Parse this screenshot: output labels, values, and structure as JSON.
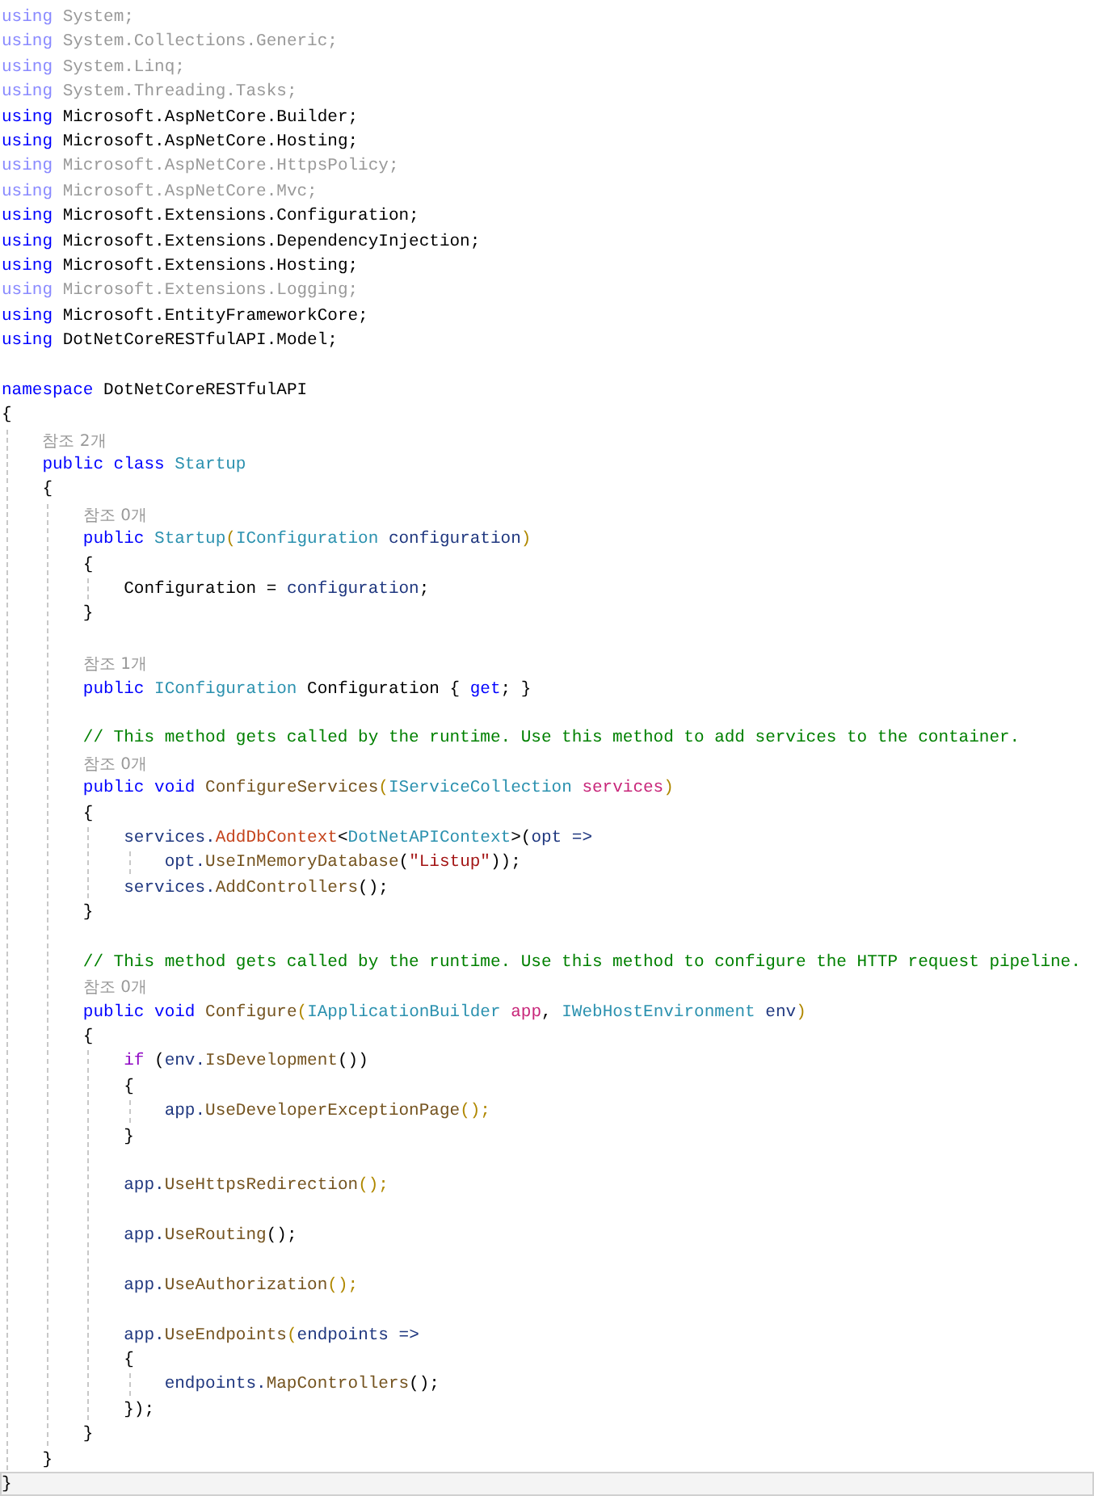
{
  "lines": [
    {
      "kind": "code",
      "current": false,
      "tokens": [
        {
          "text": "using",
          "kind": "kwf"
        },
        {
          "text": " System;",
          "kind": "fade"
        }
      ]
    },
    {
      "kind": "code",
      "current": false,
      "tokens": [
        {
          "text": "using",
          "kind": "kwf"
        },
        {
          "text": " System.Collections.Generic;",
          "kind": "fade"
        }
      ]
    },
    {
      "kind": "code",
      "current": false,
      "tokens": [
        {
          "text": "using",
          "kind": "kwf"
        },
        {
          "text": " System.Linq;",
          "kind": "fade"
        }
      ]
    },
    {
      "kind": "code",
      "current": false,
      "tokens": [
        {
          "text": "using",
          "kind": "kwf"
        },
        {
          "text": " System.Threading.Tasks;",
          "kind": "fade"
        }
      ]
    },
    {
      "kind": "code",
      "current": false,
      "tokens": [
        {
          "text": "using",
          "kind": "kw"
        },
        {
          "text": " Microsoft.AspNetCore.Builder;",
          "kind": "plain"
        }
      ]
    },
    {
      "kind": "code",
      "current": false,
      "tokens": [
        {
          "text": "using",
          "kind": "kw"
        },
        {
          "text": " Microsoft.AspNetCore.Hosting;",
          "kind": "plain"
        }
      ]
    },
    {
      "kind": "code",
      "current": false,
      "tokens": [
        {
          "text": "using",
          "kind": "kwf"
        },
        {
          "text": " Microsoft.AspNetCore.HttpsPolicy;",
          "kind": "fade"
        }
      ]
    },
    {
      "kind": "code",
      "current": false,
      "tokens": [
        {
          "text": "using",
          "kind": "kwf"
        },
        {
          "text": " Microsoft.AspNetCore.Mvc;",
          "kind": "fade"
        }
      ]
    },
    {
      "kind": "code",
      "current": false,
      "tokens": [
        {
          "text": "using",
          "kind": "kw"
        },
        {
          "text": " Microsoft.Extensions.Configuration;",
          "kind": "plain"
        }
      ]
    },
    {
      "kind": "code",
      "current": false,
      "tokens": [
        {
          "text": "using",
          "kind": "kw"
        },
        {
          "text": " Microsoft.Extensions.DependencyInjection;",
          "kind": "plain"
        }
      ]
    },
    {
      "kind": "code",
      "current": false,
      "tokens": [
        {
          "text": "using",
          "kind": "kw"
        },
        {
          "text": " Microsoft.Extensions.Hosting;",
          "kind": "plain"
        }
      ]
    },
    {
      "kind": "code",
      "current": false,
      "tokens": [
        {
          "text": "using",
          "kind": "kwf"
        },
        {
          "text": " Microsoft.Extensions.Logging;",
          "kind": "fade"
        }
      ]
    },
    {
      "kind": "code",
      "current": false,
      "tokens": [
        {
          "text": "using",
          "kind": "kw"
        },
        {
          "text": " Microsoft.EntityFrameworkCore;",
          "kind": "plain"
        }
      ]
    },
    {
      "kind": "code",
      "current": false,
      "tokens": [
        {
          "text": "using",
          "kind": "kw"
        },
        {
          "text": " DotNetCoreRESTfulAPI.Model;",
          "kind": "plain"
        }
      ]
    },
    {
      "kind": "blank",
      "current": false
    },
    {
      "kind": "code",
      "current": false,
      "tokens": [
        {
          "text": "namespace",
          "kind": "kw"
        },
        {
          "text": " DotNetCoreRESTfulAPI",
          "kind": "plain"
        }
      ]
    },
    {
      "kind": "code",
      "current": false,
      "tokens": [
        {
          "text": "{",
          "kind": "plain"
        }
      ]
    },
    {
      "kind": "lens",
      "current": false,
      "text": "    참조 2개"
    },
    {
      "kind": "code",
      "current": false,
      "tokens": [
        {
          "text": "    public class ",
          "kind": "kw"
        },
        {
          "text": "Startup",
          "kind": "type"
        }
      ]
    },
    {
      "kind": "code",
      "current": false,
      "tokens": [
        {
          "text": "    {",
          "kind": "plain"
        }
      ]
    },
    {
      "kind": "lens",
      "current": false,
      "text": "        참조 0개"
    },
    {
      "kind": "code",
      "current": false,
      "tokens": [
        {
          "text": "        public ",
          "kind": "kw"
        },
        {
          "text": "Startup",
          "kind": "type"
        },
        {
          "text": "(",
          "kind": "brace"
        },
        {
          "text": "IConfiguration",
          "kind": "type"
        },
        {
          "text": " configuration",
          "kind": "param"
        },
        {
          "text": ")",
          "kind": "brace"
        }
      ]
    },
    {
      "kind": "code",
      "current": false,
      "tokens": [
        {
          "text": "        {",
          "kind": "plain"
        }
      ]
    },
    {
      "kind": "code",
      "current": false,
      "tokens": [
        {
          "text": "            Configuration = ",
          "kind": "plain"
        },
        {
          "text": "configuration",
          "kind": "param"
        },
        {
          "text": ";",
          "kind": "plain"
        }
      ]
    },
    {
      "kind": "code",
      "current": false,
      "tokens": [
        {
          "text": "        }",
          "kind": "plain"
        }
      ]
    },
    {
      "kind": "blank",
      "current": false
    },
    {
      "kind": "lens",
      "current": false,
      "text": "        참조 1개"
    },
    {
      "kind": "code",
      "current": false,
      "tokens": [
        {
          "text": "        public ",
          "kind": "kw"
        },
        {
          "text": "IConfiguration",
          "kind": "type"
        },
        {
          "text": " Configuration { ",
          "kind": "plain"
        },
        {
          "text": "get",
          "kind": "kw"
        },
        {
          "text": "; }",
          "kind": "plain"
        }
      ]
    },
    {
      "kind": "blank",
      "current": false
    },
    {
      "kind": "code",
      "current": false,
      "tokens": [
        {
          "text": "        // This method gets called by the runtime. Use this method to add services to the container.",
          "kind": "comment"
        }
      ]
    },
    {
      "kind": "lens",
      "current": false,
      "text": "        참조 0개"
    },
    {
      "kind": "code",
      "current": false,
      "tokens": [
        {
          "text": "        public void ",
          "kind": "kw"
        },
        {
          "text": "ConfigureServices",
          "kind": "method"
        },
        {
          "text": "(",
          "kind": "brace"
        },
        {
          "text": "IServiceCollection",
          "kind": "type"
        },
        {
          "text": " services",
          "kind": "ref"
        },
        {
          "text": ")",
          "kind": "brace"
        }
      ]
    },
    {
      "kind": "code",
      "current": false,
      "tokens": [
        {
          "text": "        {",
          "kind": "plain"
        }
      ]
    },
    {
      "kind": "code",
      "current": false,
      "tokens": [
        {
          "text": "            services.",
          "kind": "param"
        },
        {
          "text": "AddDbContext",
          "kind": "ext"
        },
        {
          "text": "<",
          "kind": "plain"
        },
        {
          "text": "DotNetAPIContext",
          "kind": "type"
        },
        {
          "text": ">(",
          "kind": "plain"
        },
        {
          "text": "opt =>",
          "kind": "param"
        }
      ]
    },
    {
      "kind": "code",
      "current": false,
      "tokens": [
        {
          "text": "                opt.",
          "kind": "param"
        },
        {
          "text": "UseInMemoryDatabase",
          "kind": "method"
        },
        {
          "text": "(",
          "kind": "plain"
        },
        {
          "text": "\"Listup\"",
          "kind": "string"
        },
        {
          "text": "));",
          "kind": "plain"
        }
      ]
    },
    {
      "kind": "code",
      "current": false,
      "tokens": [
        {
          "text": "            services.",
          "kind": "param"
        },
        {
          "text": "AddControllers",
          "kind": "method"
        },
        {
          "text": "();",
          "kind": "plain"
        }
      ]
    },
    {
      "kind": "code",
      "current": false,
      "tokens": [
        {
          "text": "        }",
          "kind": "plain"
        }
      ]
    },
    {
      "kind": "blank",
      "current": false
    },
    {
      "kind": "code",
      "current": false,
      "tokens": [
        {
          "text": "        // This method gets called by the runtime. Use this method to configure the HTTP request pipeline.",
          "kind": "comment"
        }
      ]
    },
    {
      "kind": "lens",
      "current": false,
      "text": "        참조 0개"
    },
    {
      "kind": "code",
      "current": false,
      "tokens": [
        {
          "text": "        public void ",
          "kind": "kw"
        },
        {
          "text": "Configure",
          "kind": "method"
        },
        {
          "text": "(",
          "kind": "brace"
        },
        {
          "text": "IApplicationBuilder",
          "kind": "type"
        },
        {
          "text": " app",
          "kind": "ref"
        },
        {
          "text": ", ",
          "kind": "plain"
        },
        {
          "text": "IWebHostEnvironment",
          "kind": "type"
        },
        {
          "text": " env",
          "kind": "param"
        },
        {
          "text": ")",
          "kind": "brace"
        }
      ]
    },
    {
      "kind": "code",
      "current": false,
      "tokens": [
        {
          "text": "        {",
          "kind": "plain"
        }
      ]
    },
    {
      "kind": "code",
      "current": false,
      "tokens": [
        {
          "text": "            if",
          "kind": "ctrl"
        },
        {
          "text": " (",
          "kind": "plain"
        },
        {
          "text": "env.",
          "kind": "param"
        },
        {
          "text": "IsDevelopment",
          "kind": "method"
        },
        {
          "text": "())",
          "kind": "plain"
        }
      ]
    },
    {
      "kind": "code",
      "current": false,
      "tokens": [
        {
          "text": "            {",
          "kind": "plain"
        }
      ]
    },
    {
      "kind": "code",
      "current": false,
      "tokens": [
        {
          "text": "                app.",
          "kind": "param"
        },
        {
          "text": "UseDeveloperExceptionPage",
          "kind": "method"
        },
        {
          "text": "();",
          "kind": "brace"
        }
      ]
    },
    {
      "kind": "code",
      "current": false,
      "tokens": [
        {
          "text": "            }",
          "kind": "plain"
        }
      ]
    },
    {
      "kind": "blank",
      "current": false
    },
    {
      "kind": "code",
      "current": false,
      "tokens": [
        {
          "text": "            app.",
          "kind": "param"
        },
        {
          "text": "UseHttpsRedirection",
          "kind": "method"
        },
        {
          "text": "();",
          "kind": "brace"
        }
      ]
    },
    {
      "kind": "blank",
      "current": false
    },
    {
      "kind": "code",
      "current": false,
      "tokens": [
        {
          "text": "            app.",
          "kind": "param"
        },
        {
          "text": "UseRouting",
          "kind": "method"
        },
        {
          "text": "();",
          "kind": "plain"
        }
      ]
    },
    {
      "kind": "blank",
      "current": false
    },
    {
      "kind": "code",
      "current": false,
      "tokens": [
        {
          "text": "            app.",
          "kind": "param"
        },
        {
          "text": "UseAuthorization",
          "kind": "method"
        },
        {
          "text": "();",
          "kind": "brace"
        }
      ]
    },
    {
      "kind": "blank",
      "current": false
    },
    {
      "kind": "code",
      "current": false,
      "tokens": [
        {
          "text": "            app.",
          "kind": "param"
        },
        {
          "text": "UseEndpoints",
          "kind": "method"
        },
        {
          "text": "(",
          "kind": "brace"
        },
        {
          "text": "endpoints =>",
          "kind": "param"
        }
      ]
    },
    {
      "kind": "code",
      "current": false,
      "tokens": [
        {
          "text": "            {",
          "kind": "plain"
        }
      ]
    },
    {
      "kind": "code",
      "current": false,
      "tokens": [
        {
          "text": "                endpoints.",
          "kind": "param"
        },
        {
          "text": "MapControllers",
          "kind": "method"
        },
        {
          "text": "();",
          "kind": "plain"
        }
      ]
    },
    {
      "kind": "code",
      "current": false,
      "tokens": [
        {
          "text": "            });",
          "kind": "plain"
        }
      ]
    },
    {
      "kind": "code",
      "current": false,
      "tokens": [
        {
          "text": "        }",
          "kind": "plain"
        }
      ]
    },
    {
      "kind": "code",
      "current": false,
      "tokens": [
        {
          "text": "    }",
          "kind": "plain"
        }
      ]
    },
    {
      "kind": "code",
      "current": true,
      "tokens": [
        {
          "text": "}",
          "kind": "plain"
        }
      ]
    }
  ]
}
